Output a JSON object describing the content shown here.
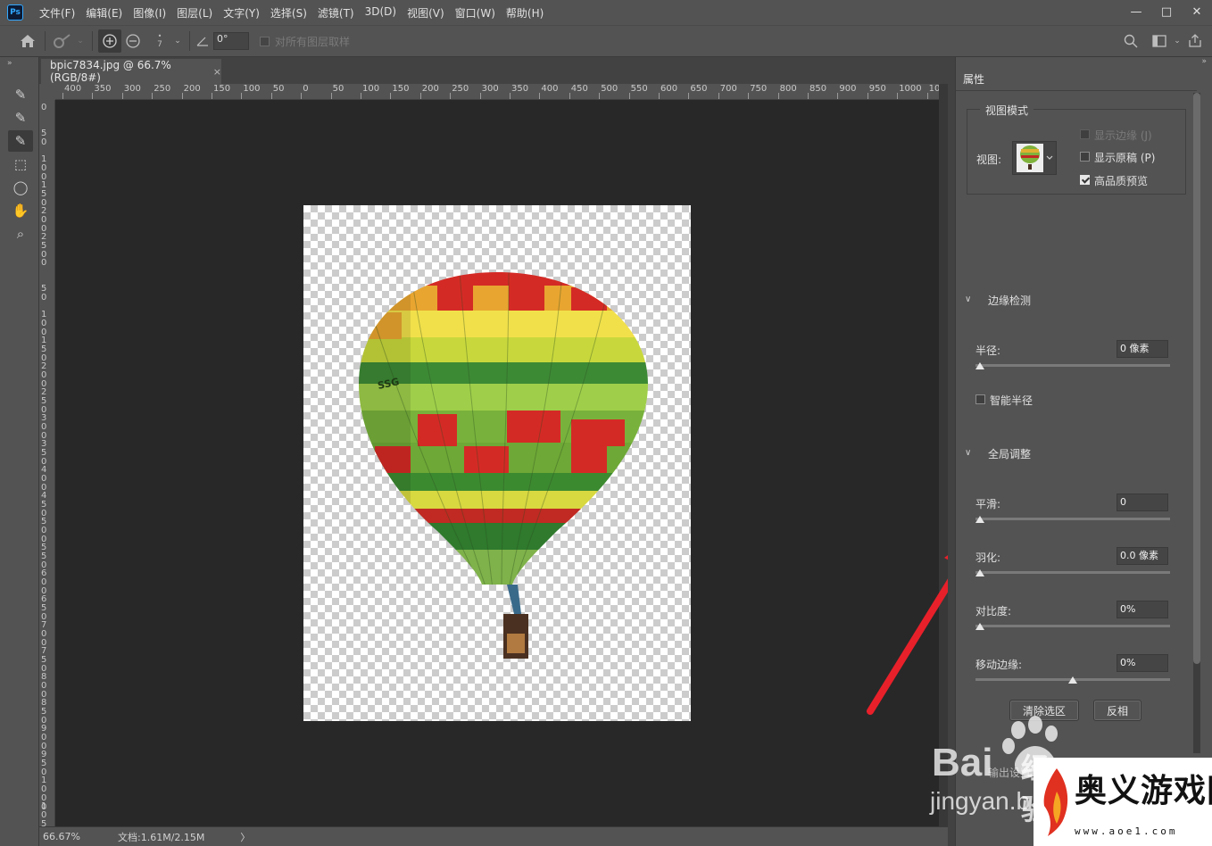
{
  "app": {
    "logo": "Ps",
    "accent_color": "#31a8ff"
  },
  "menu": [
    "文件(F)",
    "编辑(E)",
    "图像(I)",
    "图层(L)",
    "文字(Y)",
    "选择(S)",
    "滤镜(T)",
    "3D(D)",
    "视图(V)",
    "窗口(W)",
    "帮助(H)"
  ],
  "window_controls": {
    "minimize": "—",
    "maximize": "□",
    "close": "✕"
  },
  "options": {
    "brush_size": "7",
    "angle_value": "0°",
    "sample_all_layers_label": "对所有图层取样",
    "sample_all_layers_checked": false
  },
  "tools": [
    {
      "name": "quick-selection-tool",
      "icon": "✎",
      "active": false
    },
    {
      "name": "refine-edge-brush-tool",
      "icon": "✎",
      "active": false
    },
    {
      "name": "brush-tool",
      "icon": "✎",
      "active": true
    },
    {
      "name": "object-selection-tool",
      "icon": "⬚",
      "active": false
    },
    {
      "name": "lasso-tool",
      "icon": "◯",
      "active": false
    },
    {
      "name": "hand-tool",
      "icon": "✋",
      "active": false
    },
    {
      "name": "zoom-tool",
      "icon": "⌕",
      "active": false
    }
  ],
  "document": {
    "tab_title": "bpic7834.jpg @ 66.7%(RGB/8#)",
    "tab_close": "×",
    "ruler_h": [
      "400",
      "350",
      "300",
      "250",
      "200",
      "150",
      "100",
      "50",
      "0",
      "50",
      "100",
      "150",
      "200",
      "250",
      "300",
      "350",
      "400",
      "450",
      "500",
      "550",
      "600",
      "650",
      "700",
      "750",
      "800",
      "850",
      "900",
      "950",
      "1000",
      "10"
    ],
    "ruler_v": [
      "0",
      "50",
      "100",
      "150",
      "200",
      "250",
      "0",
      "50",
      "100",
      "150",
      "200",
      "250",
      "300",
      "350",
      "400",
      "450",
      "500",
      "550",
      "600",
      "650",
      "700",
      "750",
      "800",
      "850",
      "900",
      "950",
      "1000",
      "1050"
    ],
    "balloon_text": "SSG"
  },
  "status": {
    "zoom": "66.67%",
    "doc_info": "文档:1.61M/2.15M",
    "arrow": "〉"
  },
  "properties": {
    "tab": "属性",
    "view_mode": {
      "legend": "视图模式",
      "view_label": "视图:",
      "show_edge": {
        "label": "显示边缘 (J)",
        "checked": false,
        "enabled": false
      },
      "show_original": {
        "label": "显示原稿 (P)",
        "checked": false,
        "enabled": true
      },
      "hq_preview": {
        "label": "高品质预览",
        "checked": true,
        "enabled": true
      }
    },
    "edge_detection": {
      "title": "边缘检测",
      "radius_label": "半径:",
      "radius_value": "0 像素",
      "radius_level": 0,
      "smart_radius_label": "智能半径",
      "smart_radius_checked": false
    },
    "global_refinements": {
      "title": "全局调整",
      "smooth_label": "平滑:",
      "smooth_value": "0",
      "smooth_level": 0,
      "feather_label": "羽化:",
      "feather_value": "0.0 像素",
      "feather_level": 0,
      "contrast_label": "对比度:",
      "contrast_value": "0%",
      "contrast_level": 0,
      "shift_edge_label": "移动边缘:",
      "shift_edge_value": "0%",
      "shift_edge_level": 0.5
    },
    "clear_selection_button": "清除选区",
    "invert_button": "反相",
    "output_settings_label": "输出设置"
  },
  "annotation": {
    "arrow_color": "#e8202a"
  },
  "watermarks": {
    "baidu_text": "Bai",
    "baidu_suffix": "经验",
    "jingyan_text": "jingyan.b",
    "aoyi_text": "奥义游戏网",
    "aoyi_url": "www.aoe1.com"
  }
}
